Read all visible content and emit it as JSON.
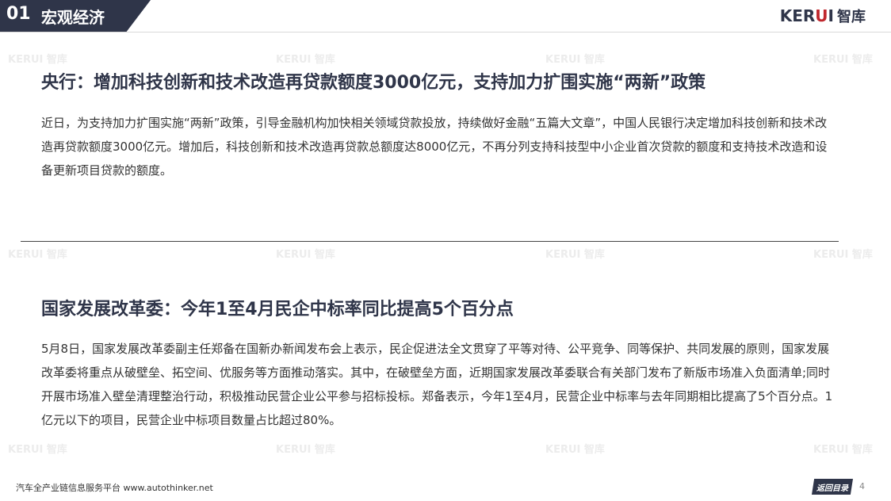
{
  "header": {
    "section_number": "01",
    "section_title": "宏观经济",
    "logo_brand_main": "KER",
    "logo_brand_accent": "U",
    "logo_brand_tail": "I",
    "logo_cn": "智库"
  },
  "watermark": {
    "text": "KERUI 智库"
  },
  "article1": {
    "title": "央行：增加科技创新和技术改造再贷款额度3000亿元，支持加力扩围实施“两新”政策",
    "body": "近日，为支持加力扩围实施“两新”政策，引导金融机构加快相关领域贷款投放，持续做好金融“五篇大文章”，中国人民银行决定增加科技创新和技术改造再贷款额度3000亿元。增加后，科技创新和技术改造再贷款总额度达8000亿元，不再分列支持科技型中小企业首次贷款的额度和支持技术改造和设备更新项目贷款的额度。"
  },
  "article2": {
    "title": "国家发展改革委：今年1至4月民企中标率同比提高5个百分点",
    "body": "5月8日，国家发展改革委副主任郑备在国新办新闻发布会上表示，民企促进法全文贯穿了平等对待、公平竞争、同等保护、共同发展的原则，国家发展改革委将重点从破壁垒、拓空间、优服务等方面推动落实。其中，在破壁垒方面，近期国家发展改革委联合有关部门发布了新版市场准入负面清单;同时开展市场准入壁垒清理整治行动，积极推动民营企业公平参与招标投标。郑备表示，今年1至4月，民营企业中标率与去年同期相比提高了5个百分点。1亿元以下的项目，民营企业中标项目数量占比超过80%。"
  },
  "footer": {
    "platform_text": "汽车全产业链信息服务平台 www.autothinker.net",
    "back_button_label": "返回目录",
    "page_number": "4"
  },
  "colors": {
    "header_bg": "#2f3549",
    "accent_red": "#c0272d",
    "title_text": "#2f3549"
  }
}
